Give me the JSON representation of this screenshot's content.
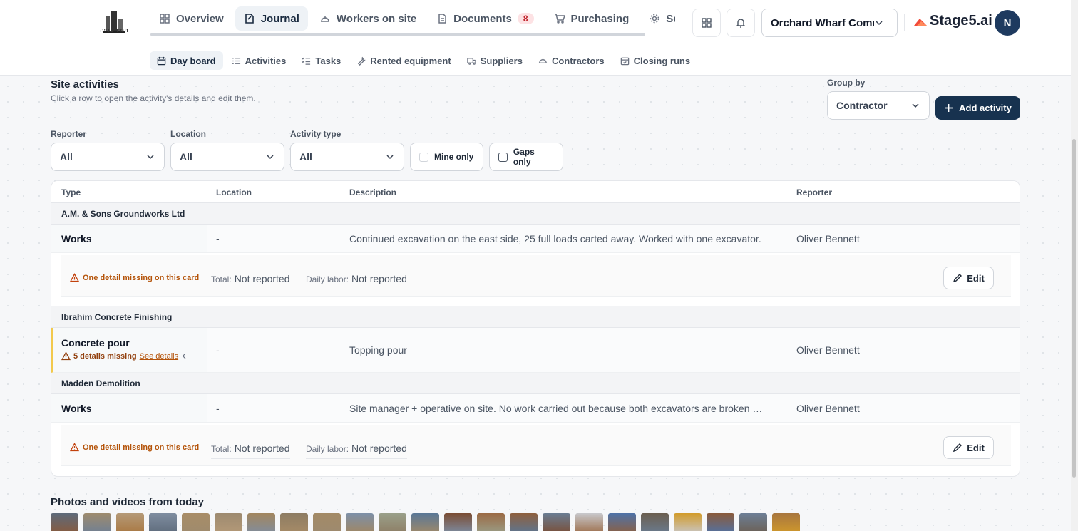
{
  "header": {
    "logo_caption": "תמיר בנייה",
    "nav": [
      {
        "label": "Overview",
        "icon": "grid-icon",
        "active": false
      },
      {
        "label": "Journal",
        "icon": "journal-icon",
        "active": true
      },
      {
        "label": "Workers on site",
        "icon": "helmet-icon",
        "active": false
      },
      {
        "label": "Documents",
        "icon": "document-icon",
        "active": false,
        "badge": "8"
      },
      {
        "label": "Purchasing",
        "icon": "cart-icon",
        "active": false
      },
      {
        "label": "Setti",
        "icon": "gear-icon",
        "active": false
      }
    ],
    "project": "Orchard Wharf Commercial",
    "brand": "Stage5.ai",
    "avatar": "N"
  },
  "subnav": [
    {
      "label": "Day board",
      "icon": "calendar-icon",
      "active": true
    },
    {
      "label": "Activities",
      "icon": "list-icon",
      "active": false
    },
    {
      "label": "Tasks",
      "icon": "checklist-icon",
      "active": false
    },
    {
      "label": "Rented equipment",
      "icon": "wrench-icon",
      "active": false
    },
    {
      "label": "Suppliers",
      "icon": "truck-icon",
      "active": false
    },
    {
      "label": "Contractors",
      "icon": "helmet-icon",
      "active": false
    },
    {
      "label": "Closing runs",
      "icon": "calendar-check-icon",
      "active": false
    }
  ],
  "section": {
    "title": "Site activities",
    "subtitle": "Click a row to open the activity's details and edit them.",
    "group_by_label": "Group by",
    "group_by_value": "Contractor",
    "add_button": "Add activity"
  },
  "filters": {
    "reporter_label": "Reporter",
    "reporter_value": "All",
    "location_label": "Location",
    "location_value": "All",
    "type_label": "Activity type",
    "type_value": "All",
    "mine_only": "Mine only",
    "gaps_only": "Gaps only"
  },
  "table": {
    "headers": {
      "type": "Type",
      "location": "Location",
      "description": "Description",
      "reporter": "Reporter"
    },
    "groups": [
      {
        "contractor": "A.M. & Sons Groundworks Ltd",
        "activity": {
          "type": "Works",
          "location": "-",
          "description": "Continued excavation on the east side, 25 full loads carted away. Worked with one excavator.",
          "reporter": "Oliver Bennett"
        },
        "detail": {
          "warning": "One detail missing on this card",
          "total_label": "Total:",
          "total_value": "Not reported",
          "labor_label": "Daily labor:",
          "labor_value": "Not reported",
          "edit": "Edit"
        }
      },
      {
        "contractor": "Ibrahim Concrete Finishing",
        "activity": {
          "type": "Concrete pour",
          "missing": "5 details missing",
          "see_details": "See details",
          "location": "-",
          "description": "Topping pour",
          "reporter": "Oliver Bennett"
        }
      },
      {
        "contractor": "Madden Demolition",
        "activity": {
          "type": "Works",
          "location": "-",
          "description": "Site manager + operative on site. No work carried out because both excavators are broken …",
          "reporter": "Oliver Bennett"
        },
        "detail": {
          "warning": "One detail missing on this card",
          "total_label": "Total:",
          "total_value": "Not reported",
          "labor_label": "Daily labor:",
          "labor_value": "Not reported",
          "edit": "Edit"
        }
      }
    ]
  },
  "photos": {
    "title": "Photos and videos from today",
    "count": 23
  }
}
